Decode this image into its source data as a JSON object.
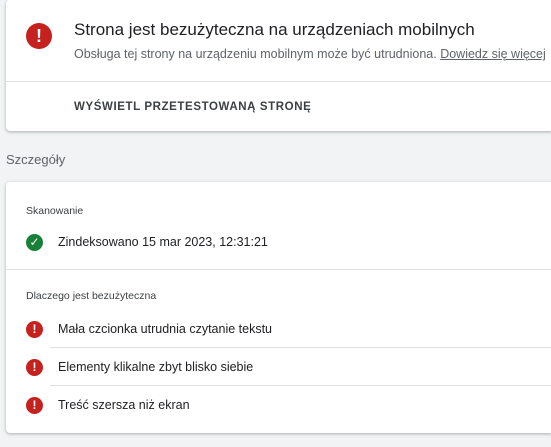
{
  "summary": {
    "status_icon": "error-icon",
    "title": "Strona jest bezużyteczna na urządzeniach mobilnych",
    "subtitle": "Obsługa tej strony na urządzeniu mobilnym może być utrudniona.",
    "learn_more": "Dowiedz się więcej",
    "view_tested_label": "WYŚWIETL PRZETESTOWANĄ STRONĘ",
    "status_color": "#c5221f"
  },
  "details": {
    "heading": "Szczegóły",
    "crawl": {
      "label": "Skanowanie",
      "status_icon": "check-circle-icon",
      "status_color": "#188038",
      "text": "Zindeksowano 15 mar 2023, 12:31:21"
    },
    "problems": {
      "label": "Dlaczego jest bezużyteczna",
      "items": [
        {
          "icon": "error-icon",
          "text": "Mała czcionka utrudnia czytanie tekstu"
        },
        {
          "icon": "error-icon",
          "text": "Elementy klikalne zbyt blisko siebie"
        },
        {
          "icon": "error-icon",
          "text": "Treść szersza niż ekran"
        }
      ]
    }
  }
}
